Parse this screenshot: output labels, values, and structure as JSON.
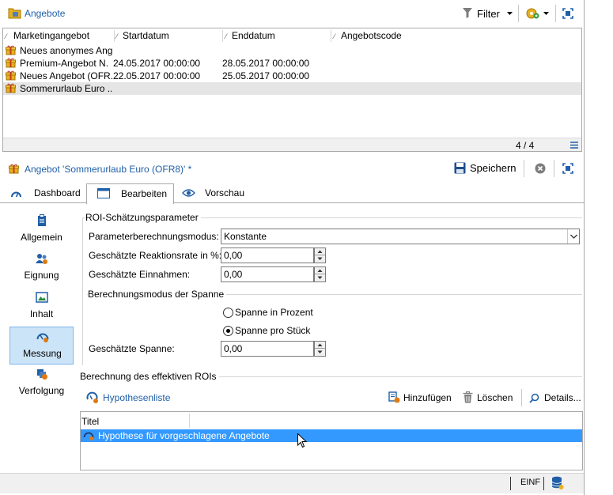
{
  "header": {
    "title": "Angebote",
    "filter_label": "Filter"
  },
  "list": {
    "columns": [
      "Marketingangebot",
      "Startdatum",
      "Enddatum",
      "Angebotscode"
    ],
    "rows": [
      {
        "name": "Neues anonymes Ang",
        "start": "",
        "end": "",
        "code": ""
      },
      {
        "name": "Premium-Angebot N.",
        "start": "24.05.2017 00:00:00",
        "end": "28.05.2017 00:00:00",
        "code": ""
      },
      {
        "name": "Neues Angebot (OFR...",
        "start": "22.05.2017 00:00:00",
        "end": "25.05.2017 00:00:00",
        "code": ""
      },
      {
        "name": "Sommerurlaub Euro ..",
        "start": "",
        "end": "",
        "code": ""
      }
    ],
    "pager": "4 / 4"
  },
  "detail": {
    "title": "Angebot 'Sommerurlaub Euro (OFR8)' *",
    "save_label": "Speichern"
  },
  "tabs": [
    {
      "label": "Dashboard"
    },
    {
      "label": "Bearbeiten"
    },
    {
      "label": "Vorschau"
    }
  ],
  "nav": [
    {
      "label": "Allgemein"
    },
    {
      "label": "Eignung"
    },
    {
      "label": "Inhalt"
    },
    {
      "label": "Messung"
    },
    {
      "label": "Verfolgung"
    }
  ],
  "form": {
    "group_title": "ROI-Schätzungsparameter",
    "mode_label": "Parameterberechnungsmodus:",
    "mode_value": "Konstante",
    "rate_label": "Geschätzte Reaktionsrate in %:",
    "rate_value": "0,00",
    "revenue_label": "Geschätzte Einnahmen:",
    "revenue_value": "0,00",
    "margin_group": "Berechnungsmodus der Spanne",
    "radio_percent": "Spanne in Prozent",
    "radio_piece": "Spanne pro Stück",
    "margin_label": "Geschätzte Spanne:",
    "margin_value": "0,00"
  },
  "roi": {
    "group_title": "Berechnung des effektiven ROIs",
    "hyp_list_label": "Hypothesenliste",
    "add_label": "Hinzufügen",
    "delete_label": "Löschen",
    "details_label": "Details...",
    "col_title": "Titel",
    "hyp_row": "Hypothese für vorgeschlagene Angebote"
  },
  "status": {
    "mode": "EINF"
  },
  "colors": {
    "accent": "#1f5fa8",
    "selection": "#3399ff",
    "nav_selected": "#cce4f7",
    "gift": "#e8b020"
  }
}
